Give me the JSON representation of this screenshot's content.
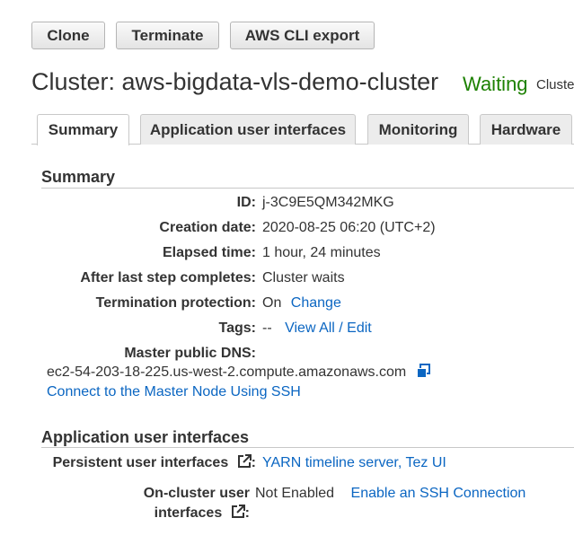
{
  "toolbar": {
    "clone_label": "Clone",
    "terminate_label": "Terminate",
    "export_label": "AWS CLI export"
  },
  "header": {
    "title": "Cluster: aws-bigdata-vls-demo-cluster",
    "status": "Waiting",
    "status_extra": "Cluste",
    "status_color": "#1d8102"
  },
  "tabs": [
    {
      "label": "Summary",
      "active": true
    },
    {
      "label": "Application user interfaces",
      "active": false
    },
    {
      "label": "Monitoring",
      "active": false
    },
    {
      "label": "Hardware",
      "active": false
    }
  ],
  "summary": {
    "heading": "Summary",
    "id_label": "ID:",
    "id_value": "j-3C9E5QM342MKG",
    "creation_label": "Creation date:",
    "creation_value": "2020-08-25 06:20 (UTC+2)",
    "elapsed_label": "Elapsed time:",
    "elapsed_value": "1 hour, 24 minutes",
    "after_label": "After last step completes:",
    "after_value": "Cluster waits",
    "termination_label": "Termination protection:",
    "termination_value": "On",
    "termination_link": "Change",
    "tags_label": "Tags:",
    "tags_value": "--",
    "tags_link": "View All / Edit",
    "dns_label": "Master public DNS:",
    "dns_value": "ec2-54-203-18-225.us-west-2.compute.amazonaws.com",
    "ssh_link": "Connect to the Master Node Using SSH"
  },
  "app_ui": {
    "heading": "Application user interfaces",
    "persistent_label": "Persistent user interfaces",
    "persistent_colon": ":",
    "yarn_link": "YARN timeline server",
    "sep": ",",
    "tez_link": "Tez UI",
    "oncluster_label_1": "On-cluster user",
    "oncluster_label_2": "interfaces",
    "oncluster_colon": ":",
    "oncluster_value": "Not Enabled",
    "oncluster_link": "Enable an SSH Connection"
  },
  "colors": {
    "link": "#0b66c2",
    "text": "#333333",
    "border": "#c8c8c8"
  },
  "icons": [
    "copy-icon",
    "external-link-icon"
  ]
}
